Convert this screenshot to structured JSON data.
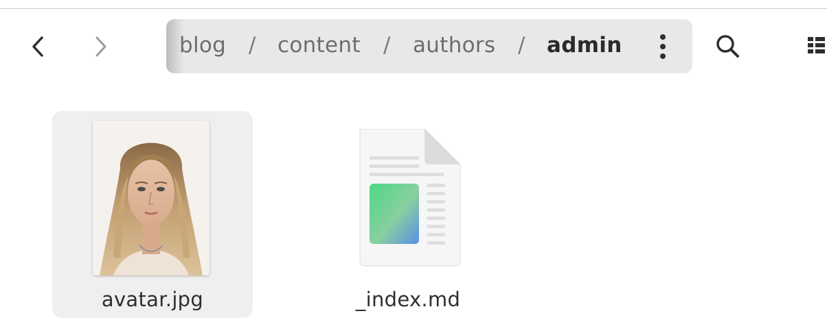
{
  "header": {
    "back_icon": "chevron-left-icon",
    "forward_icon": "chevron-right-icon",
    "menu_icon": "vertical-dots-icon",
    "search_icon": "search-icon",
    "view_icon": "list-view-icon"
  },
  "pathbar": {
    "crumbs": [
      "blog",
      "content",
      "authors",
      "admin"
    ],
    "separator": "/",
    "current": "admin"
  },
  "files": [
    {
      "name": "avatar.jpg",
      "kind": "image-thumbnail",
      "selected": true
    },
    {
      "name": "_index.md",
      "kind": "text-document-icon",
      "selected": false
    }
  ],
  "colors": {
    "pathbar_bg": "#e8e8e8",
    "selection_bg": "#efefef",
    "text": "#2e2e2e",
    "muted_text": "#6d6d6d"
  }
}
